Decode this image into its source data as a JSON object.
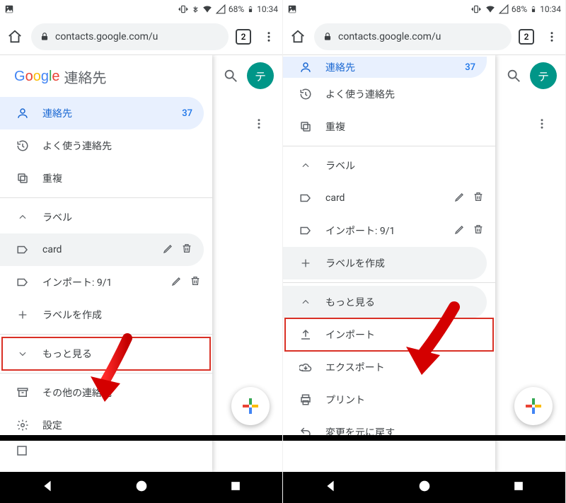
{
  "status": {
    "battery": "68%",
    "time": "10:34"
  },
  "browser": {
    "url": "contacts.google.com/u",
    "tabcount": "2"
  },
  "app": {
    "google_word": "Google",
    "title": "連絡先",
    "avatar_letter": "テ"
  },
  "left": {
    "contacts": {
      "label": "連絡先",
      "count": "37"
    },
    "frequent": {
      "label": "よく使う連絡先"
    },
    "duplicates": {
      "label": "重複"
    },
    "labels_header": "ラベル",
    "label_card": "card",
    "label_import": "インポート: 9/1",
    "create_label": "ラベルを作成",
    "more": "もっと見る",
    "other_contacts": "その他の連絡先",
    "settings": "設定"
  },
  "right": {
    "contacts": {
      "label": "連絡先",
      "count": "37"
    },
    "frequent": {
      "label": "よく使う連絡先"
    },
    "duplicates": {
      "label": "重複"
    },
    "labels_header": "ラベル",
    "label_card": "card",
    "label_import": "インポート: 9/1",
    "create_label": "ラベルを作成",
    "more": "もっと見る",
    "import": "インポート",
    "export": "エクスポート",
    "print": "プリント",
    "undo": "変更を元に戻す"
  }
}
